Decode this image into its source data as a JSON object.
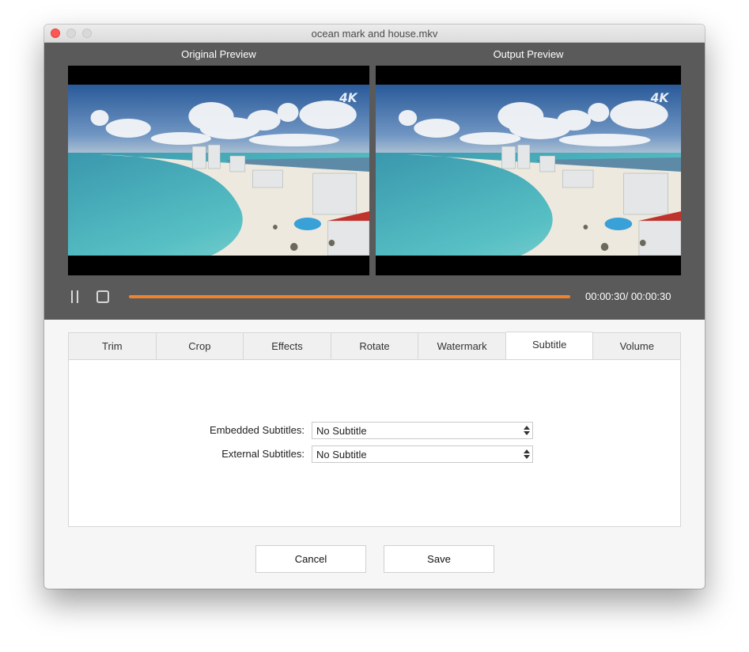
{
  "window": {
    "title": "ocean mark and house.mkv",
    "traffic_lights": [
      "close",
      "minimize",
      "zoom"
    ]
  },
  "preview": {
    "original_label": "Original Preview",
    "output_label": "Output  Preview",
    "watermark_text": "4K"
  },
  "playback": {
    "pause_icon": "pause-icon",
    "stop_icon": "stop-icon",
    "progress_fraction": 1.0,
    "current_time": "00:00:30",
    "total_time": "00:00:30",
    "time_display": "00:00:30/ 00:00:30"
  },
  "tabs": [
    {
      "label": "Trim",
      "active": false
    },
    {
      "label": "Crop",
      "active": false
    },
    {
      "label": "Effects",
      "active": false
    },
    {
      "label": "Rotate",
      "active": false
    },
    {
      "label": "Watermark",
      "active": false
    },
    {
      "label": "Subtitle",
      "active": true
    },
    {
      "label": "Volume",
      "active": false
    }
  ],
  "subtitle_panel": {
    "embedded_label": "Embedded Subtitles:",
    "embedded_value": "No Subtitle",
    "external_label": "External Subtitles:",
    "external_value": "No Subtitle"
  },
  "buttons": {
    "cancel": "Cancel",
    "save": "Save"
  },
  "colors": {
    "accent_progress": "#f0832c",
    "preview_bg": "#5a5a5a",
    "close_button": "#fc5753"
  }
}
